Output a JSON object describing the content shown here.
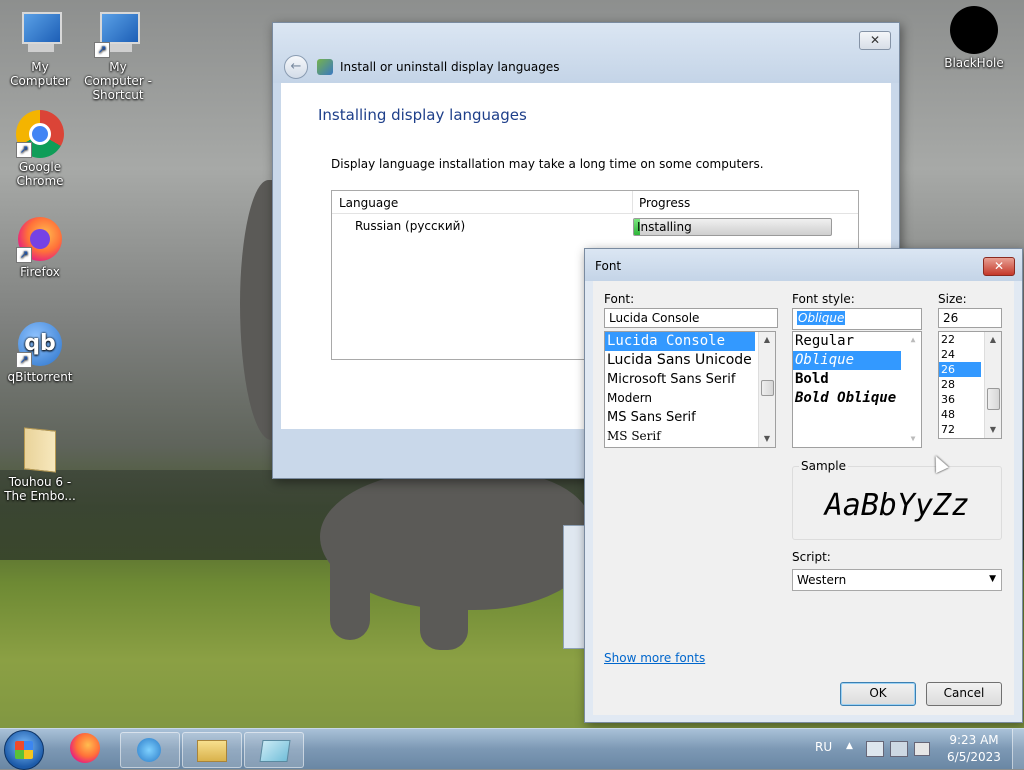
{
  "desktop": {
    "icons": [
      {
        "label": "My Computer"
      },
      {
        "label": "My Computer - Shortcut"
      },
      {
        "label": "Google Chrome"
      },
      {
        "label": "Firefox"
      },
      {
        "label": "qBittorrent"
      },
      {
        "label": "Touhou 6  - The Embo..."
      },
      {
        "label": "BlackHole"
      }
    ]
  },
  "installer": {
    "title": "Install or uninstall display languages",
    "heading": "Installing display languages",
    "description": "Display language installation may take a long time on some computers.",
    "columns": {
      "language": "Language",
      "progress": "Progress"
    },
    "rows": [
      {
        "language": "Russian (русский)",
        "status": "Installing",
        "progress": 0.03
      }
    ]
  },
  "font_dialog": {
    "title": "Font",
    "font_label": "Font:",
    "font_value": "Lucida Console",
    "fonts": [
      "Lucida Console",
      "Lucida Sans Unicode",
      "Microsoft Sans Serif",
      "Modern",
      "MS Sans Serif",
      "MS Serif"
    ],
    "style_label": "Font style:",
    "style_value": "Oblique",
    "styles": [
      "Regular",
      "Oblique",
      "Bold",
      "Bold Oblique"
    ],
    "size_label": "Size:",
    "size_value": "26",
    "sizes": [
      "22",
      "24",
      "26",
      "28",
      "36",
      "48",
      "72"
    ],
    "sample_label": "Sample",
    "sample_text": "AaBbYyZz",
    "script_label": "Script:",
    "script_value": "Western",
    "show_more": "Show more fonts",
    "ok": "OK",
    "cancel": "Cancel"
  },
  "taskbar": {
    "lang": "RU",
    "time": "9:23 AM",
    "date": "6/5/2023"
  },
  "colors": {
    "accent": "#3399ff",
    "link": "#0066cc",
    "progress": "#3cc94a"
  }
}
